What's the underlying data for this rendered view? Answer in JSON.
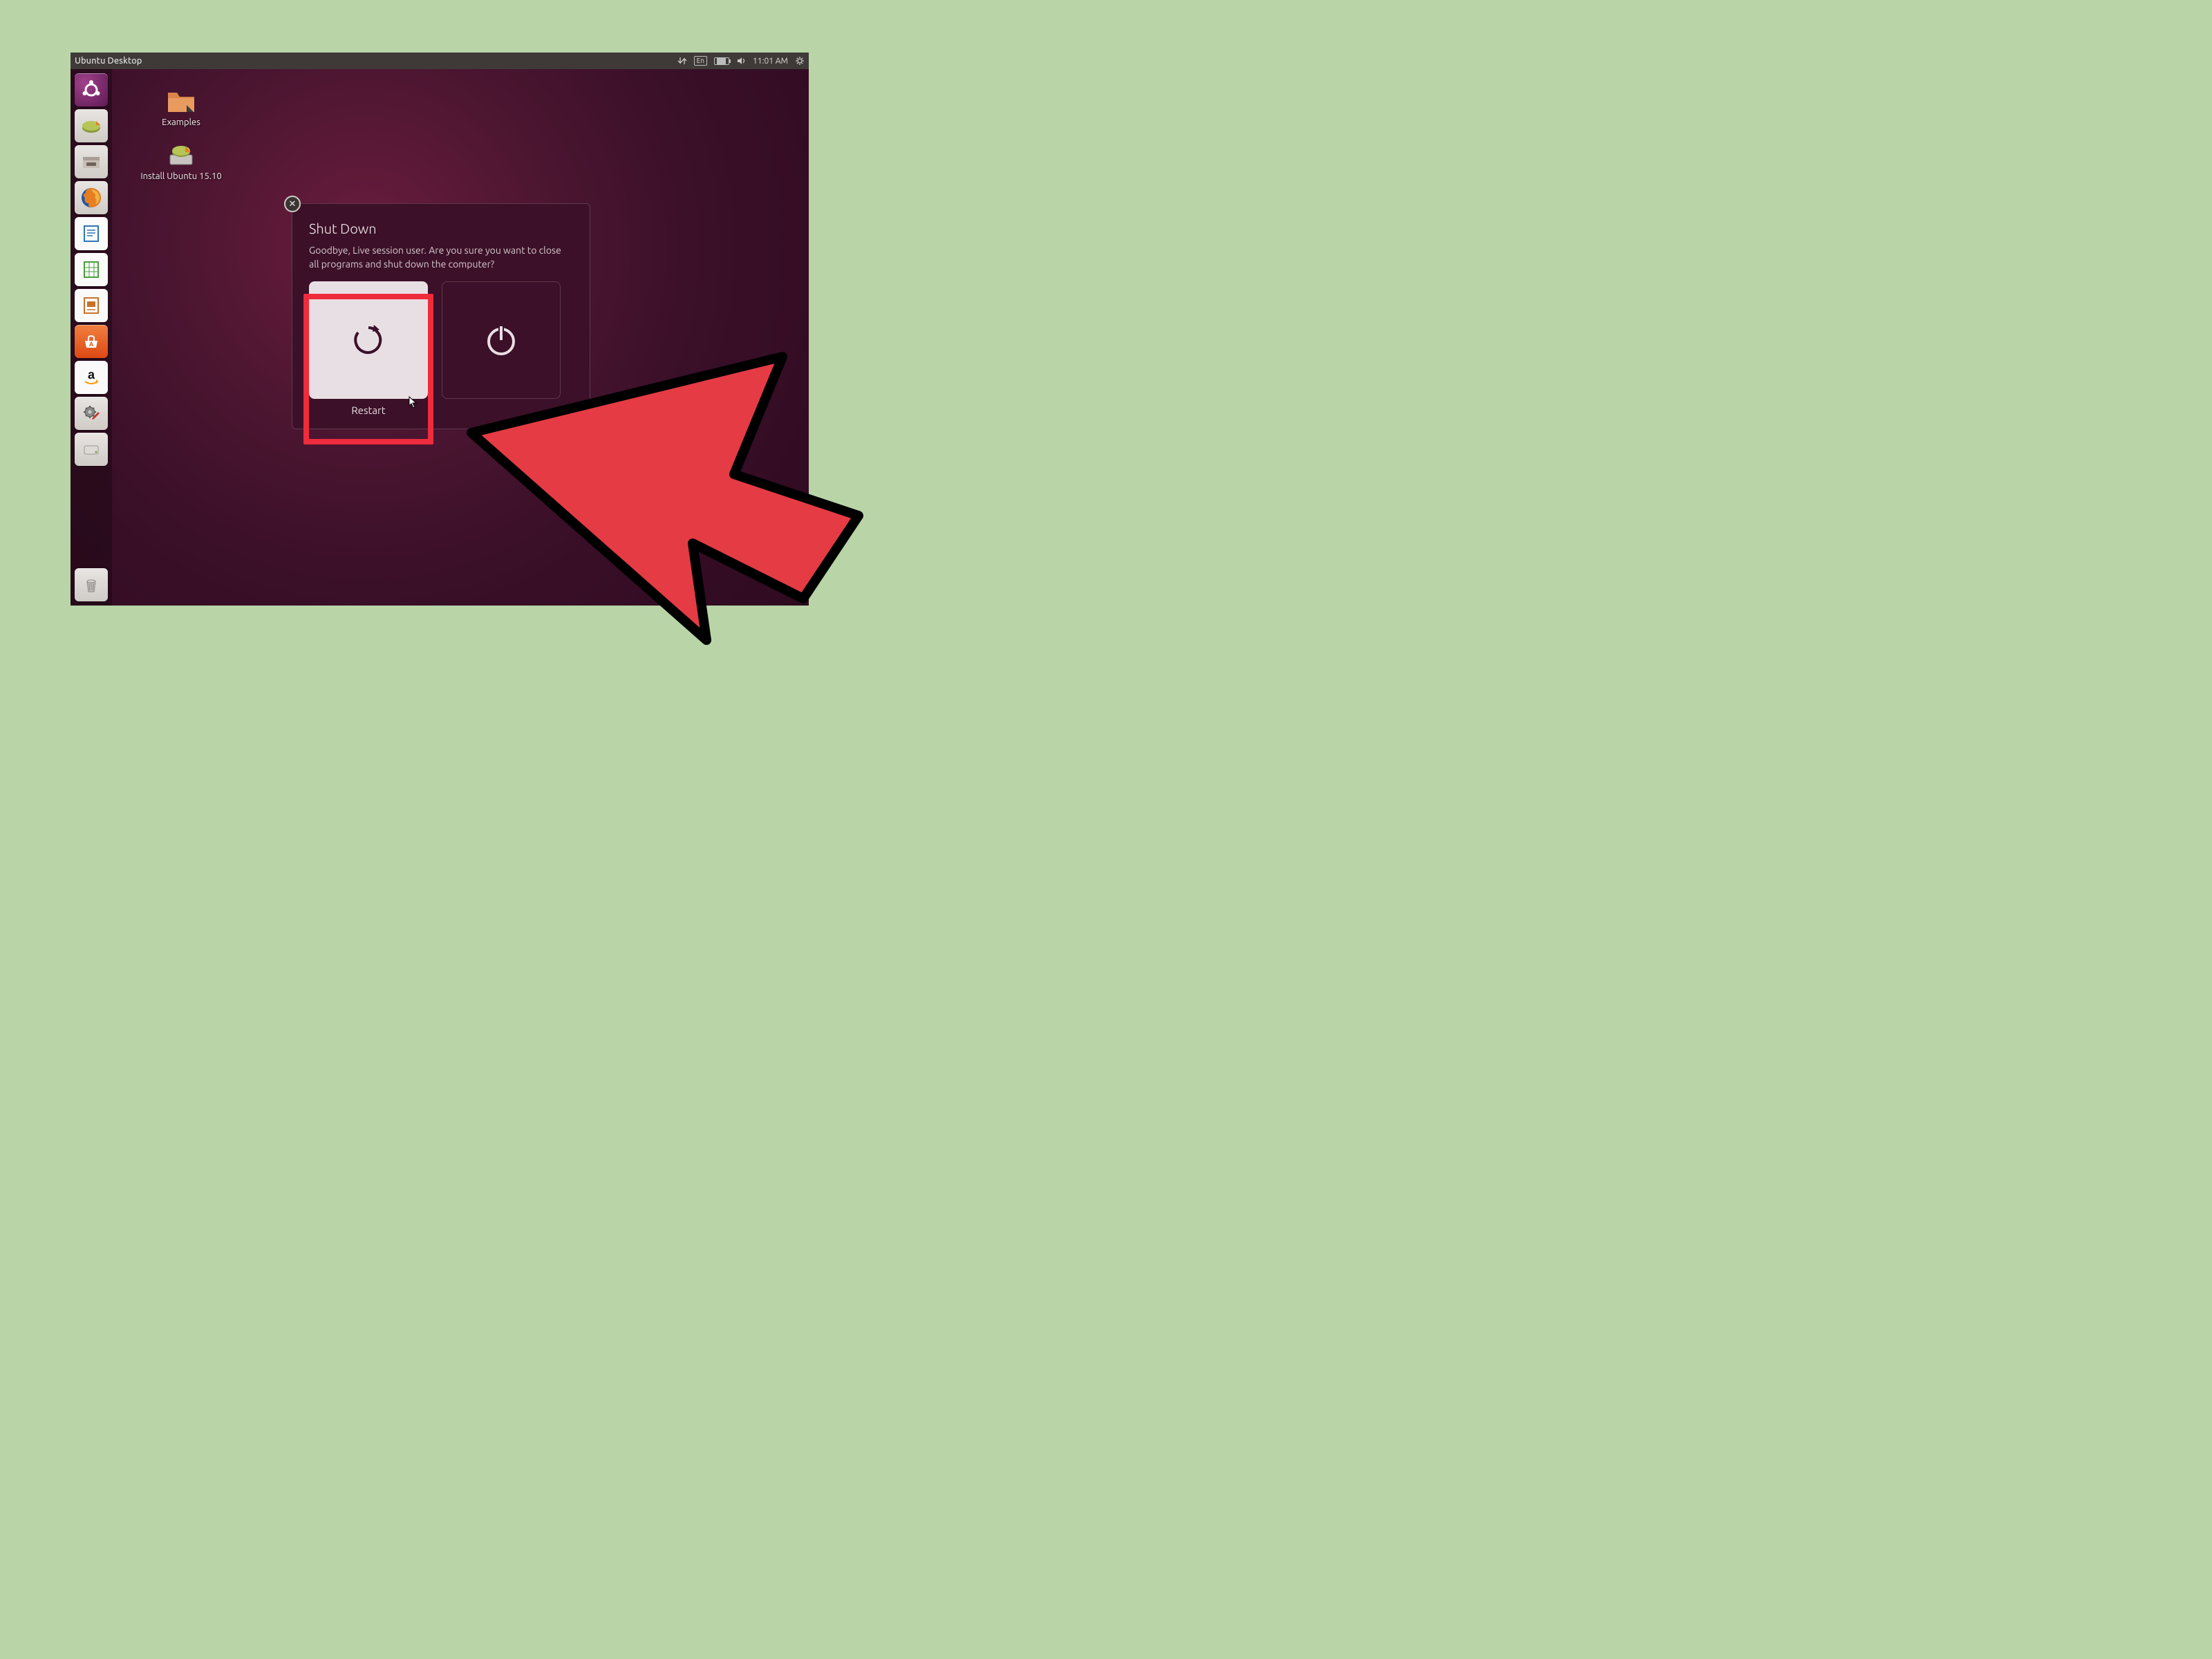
{
  "topbar": {
    "title": "Ubuntu Desktop",
    "lang": "En",
    "clock": "11:01 AM"
  },
  "desktop": {
    "icons": [
      {
        "name": "examples",
        "label": "Examples"
      },
      {
        "name": "install",
        "label": "Install Ubuntu 15.10"
      }
    ]
  },
  "launcher": [
    "dash",
    "devices",
    "files",
    "firefox",
    "writer",
    "calc",
    "impress",
    "software",
    "amazon",
    "settings",
    "disks",
    "trash"
  ],
  "dialog": {
    "title": "Shut Down",
    "body": "Goodbye, Live session user. Are you sure you want to close all programs and shut down the computer?",
    "restart_label": "Restart",
    "shutdown_label": "Shut Down"
  }
}
